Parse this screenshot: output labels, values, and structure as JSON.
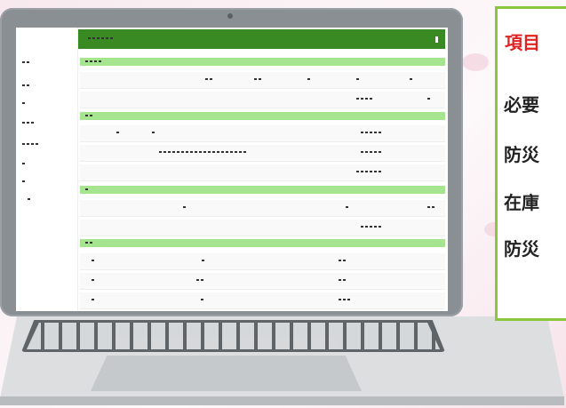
{
  "panel": {
    "title": "項目",
    "lines": [
      "必要",
      "防災",
      "在庫",
      "防災"
    ]
  },
  "screen": {
    "appbar_title": "▪▪ ▪ ▪ ▪ ▪",
    "sections": [
      "▪ ▪ ▪",
      "▪ ▪",
      "▪",
      "▪ ▪"
    ],
    "sidebar": [
      "▪ ▪",
      "▪ ▪",
      "▪",
      "▪ ▪",
      "▪ ▪ ▪",
      "▪",
      "▪",
      "▪"
    ]
  },
  "colors": {
    "appbar": "#3a8a24",
    "section": "#a6e58f",
    "panel_border": "#8cc63f",
    "panel_title": "#e02222"
  }
}
